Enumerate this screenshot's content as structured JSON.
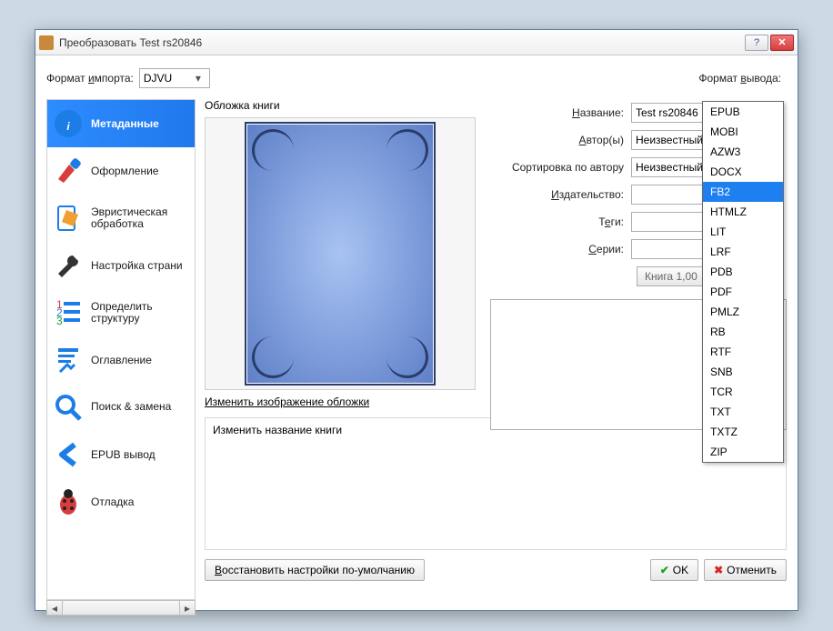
{
  "window": {
    "title": "Преобразовать Test rs20846"
  },
  "import": {
    "label": "Формат импорта:",
    "label_u": "и",
    "value": "DJVU"
  },
  "output": {
    "label": "Формат вывода:",
    "label_u": "в"
  },
  "sidebar": {
    "items": [
      {
        "label": "Метаданные"
      },
      {
        "label": "Оформление"
      },
      {
        "label": "Эвристическая обработка"
      },
      {
        "label": "Настройка страни"
      },
      {
        "label": "Определить структуру"
      },
      {
        "label": "Оглавление"
      },
      {
        "label": "Поиск & замена"
      },
      {
        "label": "EPUB вывод"
      },
      {
        "label": "Отладка"
      }
    ]
  },
  "cover": {
    "label": "Обложка книги",
    "change": "Изменить изображение обложки"
  },
  "form": {
    "title_label": "Название:",
    "title_u": "Н",
    "title_value": "Test rs20846",
    "authors_label": "Автор(ы)",
    "authors_u": "А",
    "authors_value": "Неизвестный",
    "sort_label": "Сортировка по автору",
    "sort_value": "Неизвестный",
    "publisher_label": "Издательство:",
    "publisher_u": "И",
    "publisher_value": "",
    "tags_label": "Теги:",
    "tags_u": "Т",
    "tags_value": "",
    "series_label": "Серии:",
    "series_u": "С",
    "series_value": "",
    "seriesbtn": "Книга 1,00"
  },
  "booktitle": {
    "label": "Изменить название книги"
  },
  "buttons": {
    "restore": "Восстановить настройки по-умолчанию",
    "ok": "OK",
    "cancel": "Отменить"
  },
  "dropdown": {
    "items": [
      "EPUB",
      "MOBI",
      "AZW3",
      "DOCX",
      "FB2",
      "HTMLZ",
      "LIT",
      "LRF",
      "PDB",
      "PDF",
      "PMLZ",
      "RB",
      "RTF",
      "SNB",
      "TCR",
      "TXT",
      "TXTZ",
      "ZIP"
    ],
    "selected": "FB2"
  }
}
